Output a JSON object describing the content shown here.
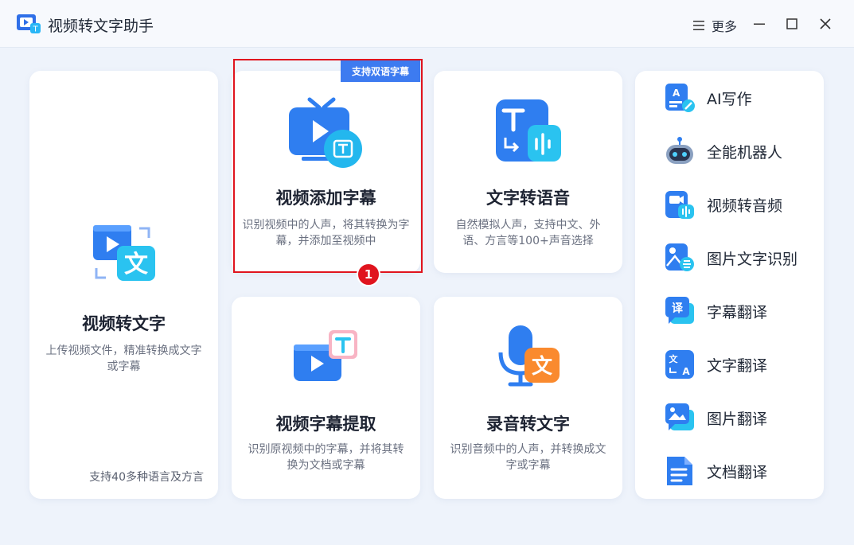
{
  "app": {
    "title": "视频转文字助手",
    "more_label": "更多"
  },
  "cards": {
    "video_to_text": {
      "title": "视频转文字",
      "desc": "上传视频文件，精准转换成文字或字幕",
      "footer": "支持40多种语言及方言"
    },
    "add_subtitle": {
      "title": "视频添加字幕",
      "desc": "识别视频中的人声，将其转换为字幕，并添加至视频中",
      "badge": "支持双语字幕",
      "step": "1"
    },
    "text_to_speech": {
      "title": "文字转语音",
      "desc": "自然模拟人声，支持中文、外语、方言等100+声音选择"
    },
    "subtitle_extract": {
      "title": "视频字幕提取",
      "desc": "识别原视频中的字幕，并将其转换为文档或字幕"
    },
    "audio_to_text": {
      "title": "录音转文字",
      "desc": "识别音频中的人声，并转换成文字或字幕"
    }
  },
  "sidebar": {
    "items": [
      {
        "label": "AI写作",
        "icon": "ai-writing-icon"
      },
      {
        "label": "全能机器人",
        "icon": "robot-icon"
      },
      {
        "label": "视频转音频",
        "icon": "video-to-audio-icon"
      },
      {
        "label": "图片文字识别",
        "icon": "image-ocr-icon"
      },
      {
        "label": "字幕翻译",
        "icon": "subtitle-translate-icon"
      },
      {
        "label": "文字翻译",
        "icon": "text-translate-icon"
      },
      {
        "label": "图片翻译",
        "icon": "image-translate-icon"
      },
      {
        "label": "文档翻译",
        "icon": "document-translate-icon"
      }
    ]
  },
  "colors": {
    "accent": "#3d7bf0",
    "highlight": "#e0141e",
    "background": "#eef3fb"
  }
}
